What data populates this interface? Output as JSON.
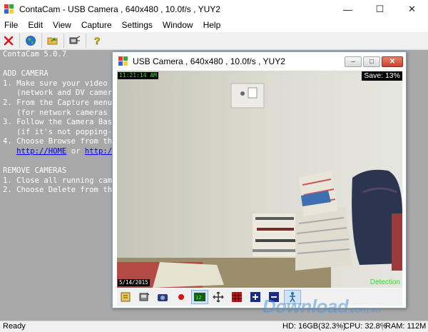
{
  "window": {
    "title": "ContaCam - USB Camera , 640x480 , 10.0f/s , YUY2",
    "controls": {
      "minimize": "—",
      "maximize": "☐",
      "close": "✕"
    }
  },
  "menu": [
    "File",
    "Edit",
    "View",
    "Capture",
    "Settings",
    "Window",
    "Help"
  ],
  "toolbar": {
    "icons": [
      "close-camera-icon",
      "network-globe-icon",
      "open-folder-icon",
      "camera-settings-icon",
      "help-icon"
    ]
  },
  "help": {
    "lines": [
      "ContaCam 5.0.7",
      "",
      "ADD CAMERA",
      "1. Make sure your video ca",
      "   (network and DV camer",
      "2. From the Capture menu",
      "   (for network cameras s",
      "3. Follow the Camera Basic",
      "   (if it's not popping-up s",
      "4. Choose Browse from the"
    ],
    "link_home": "http://HOME",
    "link_or": " or ",
    "link_other": "http://l",
    "remove_lines": [
      "",
      "REMOVE CAMERAS",
      "1. Close all running camera",
      "2. Choose Delete from the"
    ]
  },
  "camera_window": {
    "title": "USB Camera , 640x480 , 10.0f/s , YUY2",
    "controls": {
      "minimize": "–",
      "maximize": "□",
      "close": "✕"
    },
    "overlay": {
      "time": "11:21:14 AM",
      "save": "Save: 13%",
      "date": "5/14/2015",
      "detection": "Detection"
    },
    "toolbar_icons": [
      "snapshot-settings-icon",
      "save-settings-icon",
      "camera-snapshot-icon",
      "record-icon",
      "timestamp-icon",
      "move-icon",
      "grid-icon",
      "zoom-in-icon",
      "zoom-out-icon",
      "detection-icon"
    ]
  },
  "status": {
    "left": "Ready",
    "hd": "HD: 16GB(32.3%)",
    "cpu": "CPU: 32.8%",
    "ram": "RAM: 112M"
  },
  "watermark": "Download",
  "watermark_suffix": ".com.vn"
}
